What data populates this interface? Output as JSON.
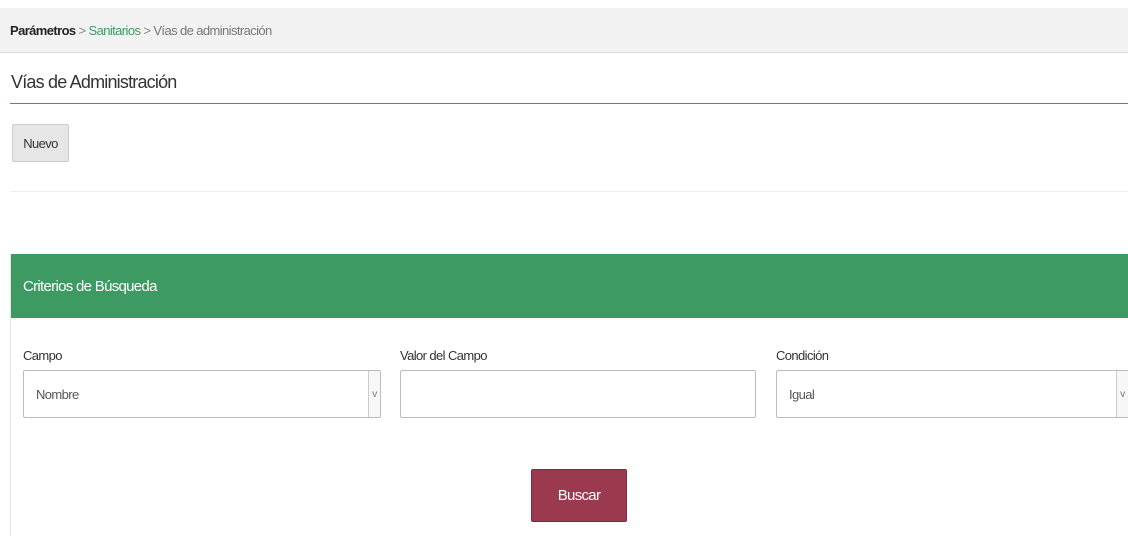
{
  "breadcrumb": {
    "root": "Parámetros",
    "separator": ">",
    "section": "Sanitarios",
    "current": "Vías de administración"
  },
  "page": {
    "title": "Vías de Administración"
  },
  "toolbar": {
    "new_label": "Nuevo"
  },
  "search_panel": {
    "header": "Criterios de Búsqueda",
    "field": {
      "label": "Campo",
      "selected": "Nombre"
    },
    "value": {
      "label": "Valor del Campo",
      "value": ""
    },
    "condition": {
      "label": "Condición",
      "selected": "Igual"
    },
    "search_label": "Buscar"
  },
  "icons": {
    "select_arrow": "chevron-down-icon",
    "select_arrow_glyph": "v"
  },
  "colors": {
    "accent_green": "#3e9a63",
    "search_button": "#9b3a4e",
    "breadcrumb_bg": "#f2f2f2"
  }
}
